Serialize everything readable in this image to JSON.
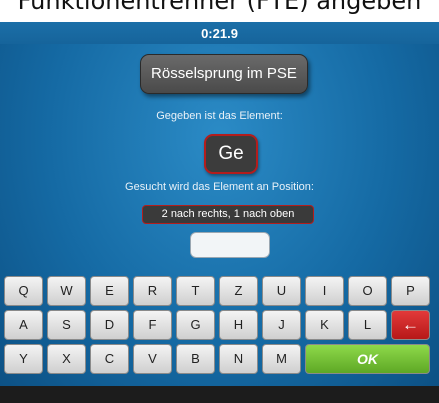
{
  "page_header": {
    "text": "Funktionentrenner (FTE) angeben"
  },
  "timer": {
    "value": "0:21.9"
  },
  "title": {
    "label": "Rösselsprung im PSE"
  },
  "given_prompt": {
    "text": "Gegeben ist das Element:"
  },
  "element": {
    "symbol": "Ge"
  },
  "search_prompt": {
    "text": "Gesucht wird das Element an Position:"
  },
  "target_position": {
    "text": "2 nach rechts, 1 nach oben"
  },
  "answer_field": {
    "value": ""
  },
  "keyboard": {
    "rows": [
      [
        "Q",
        "W",
        "E",
        "R",
        "T",
        "Z",
        "U",
        "I",
        "O",
        "P"
      ],
      [
        "A",
        "S",
        "D",
        "F",
        "G",
        "H",
        "J",
        "K",
        "L"
      ],
      [
        "Y",
        "X",
        "C",
        "V",
        "B",
        "N",
        "M"
      ]
    ],
    "backspace_label": "←",
    "ok_label": "OK"
  },
  "colors": {
    "background_blue": "#156aa4",
    "accent_red": "#b31d1d",
    "ok_green": "#6fbf2f"
  }
}
